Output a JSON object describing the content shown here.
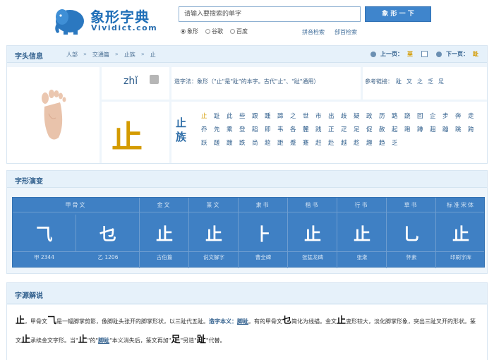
{
  "header": {
    "logo_name": "象形字典",
    "logo_domain": "Vividict.com",
    "search_placeholder": "请输入要搜索的单字",
    "search_button": "象 形 一 下",
    "radios": [
      {
        "label": "象形",
        "checked": true
      },
      {
        "label": "谷歌",
        "checked": false
      },
      {
        "label": "百度",
        "checked": false
      }
    ],
    "links": [
      "拼音检索",
      "部首检索"
    ]
  },
  "info": {
    "title": "字头信息",
    "breadcrumbs": [
      "人部",
      "交通篇",
      "止族",
      "止"
    ],
    "prev_label": "上一页：",
    "prev_char": "莝",
    "next_label": "下一页：",
    "next_char": "趾",
    "pinyin": "zhǐ",
    "origin": "造字法：象形（\"止\"是\"趾\"的本字。古代\"止\"、\"趾\"通用）",
    "ref_label": "参考链接：",
    "ref_links": [
      "趾",
      "又",
      "之",
      "乏",
      "足"
    ],
    "big_char": "止",
    "family_label": "止族",
    "family_chars": [
      "止",
      "趾",
      "此",
      "些",
      "跟",
      "踵",
      "蹄",
      "之",
      "世",
      "市",
      "出",
      "歧",
      "疑",
      "政",
      "历",
      "路",
      "跷",
      "回",
      "企",
      "步",
      "奔",
      "走",
      "乔",
      "先",
      "乘",
      "登",
      "蹈",
      "即",
      "韦",
      "各",
      "麓",
      "践",
      "正",
      "疋",
      "足",
      "促",
      "赦",
      "起",
      "跑",
      "蹲",
      "趄",
      "蹦",
      "跳",
      "跨",
      "跃",
      "蹉",
      "踱",
      "跌",
      "尚",
      "趑",
      "距",
      "蹙",
      "蹇",
      "赶",
      "赴",
      "越",
      "趁",
      "趣",
      "趋",
      "乏"
    ],
    "highlight_index": 0
  },
  "evolution": {
    "title": "字形演变",
    "columns": [
      {
        "name": "甲骨文",
        "items": [
          {
            "glyph": "⺄",
            "source": "甲 2344"
          },
          {
            "glyph": "乜",
            "source": "乙 1206"
          }
        ]
      },
      {
        "name": "金文",
        "items": [
          {
            "glyph": "止",
            "source": "古伯簋"
          }
        ]
      },
      {
        "name": "篆文",
        "items": [
          {
            "glyph": "止",
            "source": "说文解字"
          }
        ]
      },
      {
        "name": "隶书",
        "items": [
          {
            "glyph": "⺊",
            "source": "曹全碑"
          }
        ]
      },
      {
        "name": "楷书",
        "items": [
          {
            "glyph": "止",
            "source": "张猛龙碑"
          }
        ]
      },
      {
        "name": "行书",
        "items": [
          {
            "glyph": "止",
            "source": "张漱"
          }
        ]
      },
      {
        "name": "草书",
        "items": [
          {
            "glyph": "⺃",
            "source": "怀素"
          }
        ]
      },
      {
        "name": "标准宋体",
        "items": [
          {
            "glyph": "止",
            "source": "印刷字库"
          }
        ]
      }
    ]
  },
  "etymology": {
    "title": "字源解说",
    "zi": "止",
    "p1": "，甲骨文",
    "p2": "是一幅脚掌剪影，像脚趾头张开的脚掌形状，以三趾代五趾。",
    "label": "造字本义：",
    "meaning": "脚趾",
    "p3": "。有的甲骨文",
    "p4": "简化为线描。金文",
    "p5": "变形较大，淡化脚掌形象，突出三趾叉开的形状。篆文",
    "p6": "承续金文字形。当\"",
    "p6b": "\"的\"",
    "p7": "\"本义消失后，篆文再加\"",
    "zu": "足",
    "p8": "\"另造\"",
    "zhi2": "趾",
    "p9": "\"代替。",
    "g1": "⺄",
    "g2": "乜",
    "g3": "止",
    "g4": "止",
    "link2": "脚趾"
  }
}
